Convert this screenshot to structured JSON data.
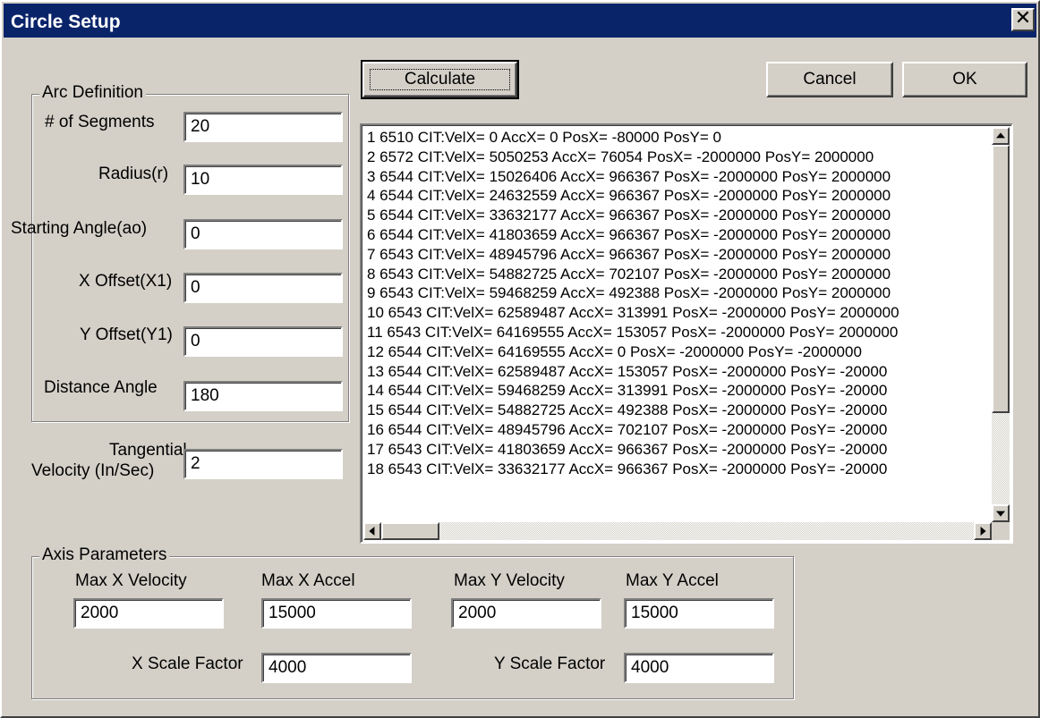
{
  "window": {
    "title": "Circle Setup",
    "close_glyph": "✕"
  },
  "buttons": {
    "calculate": "Calculate",
    "cancel": "Cancel",
    "ok": "OK"
  },
  "arc": {
    "group_title": "Arc Definition",
    "segments_label": "# of Segments",
    "segments_value": "20",
    "radius_label": "Radius(r)",
    "radius_value": "10",
    "start_angle_label": "Starting Angle(ao)",
    "start_angle_value": "0",
    "x_offset_label": "X Offset(X1)",
    "x_offset_value": "0",
    "y_offset_label": "Y Offset(Y1)",
    "y_offset_value": "0",
    "distance_angle_label": "Distance Angle",
    "distance_angle_value": "180"
  },
  "tangential": {
    "label_line1": "Tangential",
    "label_line2": "Velocity (In/Sec)",
    "value": "2"
  },
  "output_list": {
    "rows": [
      "1 6510 CIT:VelX= 0 AccX= 0 PosX= -80000 PosY= 0",
      "2 6572 CIT:VelX= 5050253 AccX= 76054 PosX= -2000000 PosY= 2000000",
      "3 6544 CIT:VelX= 15026406 AccX= 966367 PosX= -2000000 PosY= 2000000",
      "4 6544 CIT:VelX= 24632559 AccX= 966367 PosX= -2000000 PosY= 2000000",
      "5 6544 CIT:VelX= 33632177 AccX= 966367 PosX= -2000000 PosY= 2000000",
      "6 6544 CIT:VelX= 41803659 AccX= 966367 PosX= -2000000 PosY= 2000000",
      "7 6543 CIT:VelX= 48945796 AccX= 966367 PosX= -2000000 PosY= 2000000",
      "8 6543 CIT:VelX= 54882725 AccX= 702107 PosX= -2000000 PosY= 2000000",
      "9 6543 CIT:VelX= 59468259 AccX= 492388 PosX= -2000000 PosY= 2000000",
      "10 6543 CIT:VelX= 62589487 AccX= 313991 PosX= -2000000 PosY= 2000000",
      "11 6543 CIT:VelX= 64169555 AccX= 153057 PosX= -2000000 PosY= 2000000",
      "12 6544 CIT:VelX= 64169555 AccX= 0 PosX= -2000000 PosY= -2000000",
      "13 6544 CIT:VelX= 62589487 AccX= 153057 PosX= -2000000 PosY= -20000",
      "14 6544 CIT:VelX= 59468259 AccX= 313991 PosX= -2000000 PosY= -20000",
      "15 6544 CIT:VelX= 54882725 AccX= 492388 PosX= -2000000 PosY= -20000",
      "16 6544 CIT:VelX= 48945796 AccX= 702107 PosX= -2000000 PosY= -20000",
      "17 6543 CIT:VelX= 41803659 AccX= 966367 PosX= -2000000 PosY= -20000",
      "18 6543 CIT:VelX= 33632177 AccX= 966367 PosX= -2000000 PosY= -20000"
    ]
  },
  "axis": {
    "group_title": "Axis Parameters",
    "max_x_vel_label": "Max X Velocity",
    "max_x_vel_value": "2000",
    "max_x_accel_label": "Max X Accel",
    "max_x_accel_value": "15000",
    "max_y_vel_label": "Max Y Velocity",
    "max_y_vel_value": "2000",
    "max_y_accel_label": "Max Y Accel",
    "max_y_accel_value": "15000",
    "x_scale_label": "X Scale Factor",
    "x_scale_value": "4000",
    "y_scale_label": "Y Scale Factor",
    "y_scale_value": "4000"
  },
  "colors": {
    "title_bar": "#0a246a",
    "face": "#d4d0c8"
  }
}
